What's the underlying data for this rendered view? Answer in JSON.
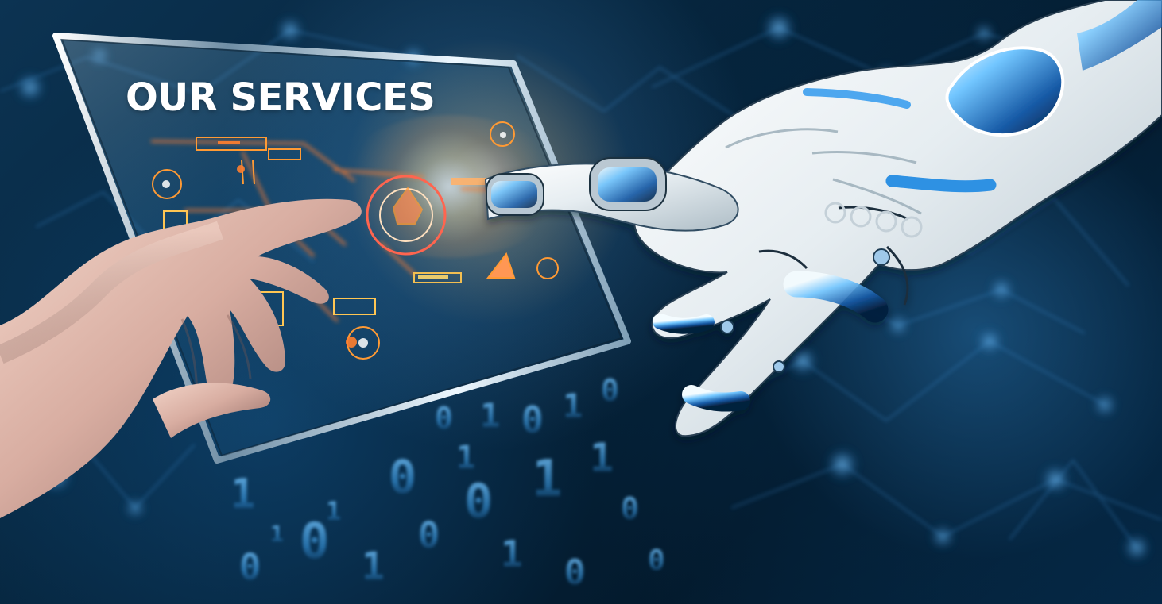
{
  "hero": {
    "title": "OUR SERVICES"
  },
  "theme": {
    "background": "#05223a",
    "accent_blue": "#59b7ff",
    "accent_orange": "#ff7b38",
    "title_color": "#ffffff"
  },
  "visuals": {
    "human_hand": "human-hand",
    "robot_hand": "robotic-hand",
    "tablet": "transparent-tablet",
    "binary_stream": "binary-code-stream",
    "network_background": "network-lines"
  }
}
